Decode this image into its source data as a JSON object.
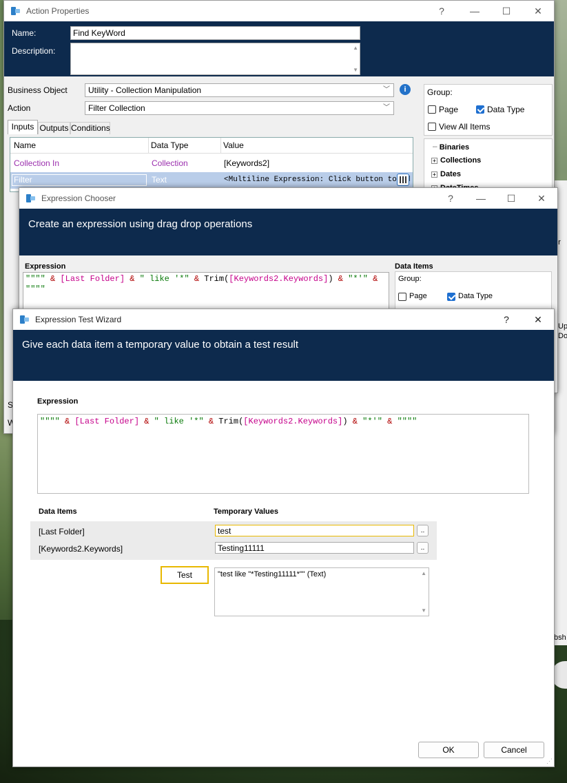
{
  "action_props": {
    "title": "Action Properties",
    "name_label": "Name:",
    "name_value": "Find KeyWord",
    "description_label": "Description:",
    "business_object_label": "Business Object",
    "business_object_value": "Utility - Collection Manipulation",
    "action_label": "Action",
    "action_value": "Filter Collection",
    "tabs": [
      "Inputs",
      "Outputs",
      "Conditions"
    ],
    "group_label": "Group:",
    "page_option": "Page",
    "data_type_option": "Data Type",
    "view_all_items": "View All Items",
    "tree": [
      "Binaries",
      "Collections",
      "Dates",
      "DateTimes"
    ],
    "table_headers": [
      "Name",
      "Data Type",
      "Value"
    ],
    "rows": [
      {
        "name": "Collection In",
        "type": "Collection",
        "value": "[Keywords2]"
      },
      {
        "name": "Filter",
        "type": "Text",
        "value": "<Multiline Expression: Click button to ed"
      }
    ],
    "side_fragments": {
      "s": "St",
      "w": "W"
    }
  },
  "expression_chooser": {
    "title": "Expression Chooser",
    "banner": "Create an expression using drag drop operations",
    "expression_label": "Expression",
    "data_items_label": "Data Items",
    "group_label": "Group:",
    "page_option": "Page",
    "data_type_option": "Data Type",
    "expression_line1": "\"\"\"\" & [Last Folder] & \" like '*\" & Trim([Keywords2.Keywords]) & \"*'\" &",
    "expression_line2": "\"\"\"\""
  },
  "wizard": {
    "title": "Expression Test Wizard",
    "help": "?",
    "banner": "Give each data item a temporary value to obtain a test result",
    "expression_label": "Expression",
    "expression": "\"\"\"\" & [Last Folder] & \" like '*\" & Trim([Keywords2.Keywords]) & \"*'\" & \"\"\"\"",
    "data_items_header": "Data Items",
    "temp_values_header": "Temporary Values",
    "items": [
      {
        "name": "[Last Folder]",
        "value": "test"
      },
      {
        "name": "[Keywords2.Keywords]",
        "value": "Testing11111"
      }
    ],
    "ellipsis": "..",
    "test_button": "Test",
    "result": "\"test like \"*Testing11111*\"\" (Text)",
    "ok": "OK",
    "cancel": "Cancel"
  },
  "background_fragments": {
    "up": "Up",
    "do": "Do",
    "or": "or",
    "bsh": "bsh"
  },
  "colors": {
    "navy": "#0d2a4d",
    "highlight": "#e8b800",
    "selection": "#b9cde9"
  }
}
